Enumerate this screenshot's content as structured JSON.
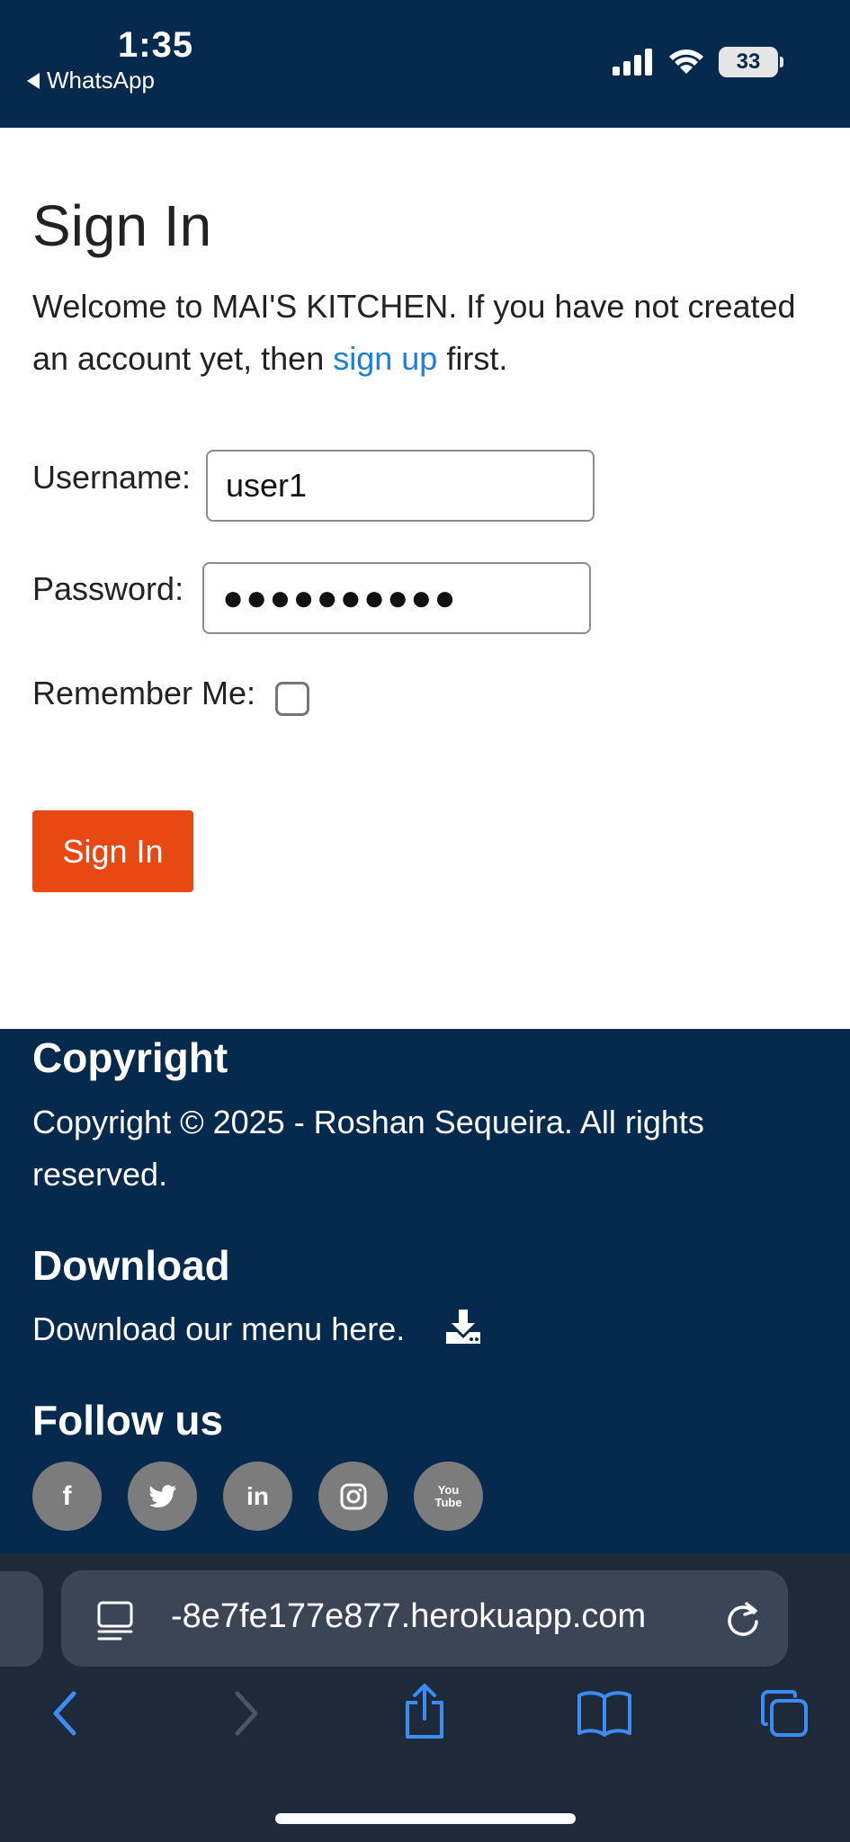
{
  "status_bar": {
    "time": "1:35",
    "back_label": "WhatsApp",
    "battery": "33"
  },
  "main": {
    "title": "Sign In",
    "welcome_text_1": "Welcome to MAI'S KITCHEN. If you have not created an account yet, then ",
    "signup_link": "sign up",
    "welcome_text_2": " first.",
    "username_label": "Username:",
    "username_value": "user1",
    "password_label": "Password:",
    "password_value": "●●●●●●●●●●",
    "remember_label": "Remember Me:",
    "signin_button": "Sign In"
  },
  "footer": {
    "copyright_heading": "Copyright",
    "copyright_text": "Copyright © 2025 - Roshan Sequeira. All rights reserved.",
    "download_heading": "Download",
    "download_text": "Download our menu here.",
    "follow_heading": "Follow us",
    "socials": [
      {
        "name": "facebook",
        "glyph": "f"
      },
      {
        "name": "twitter",
        "glyph": "t"
      },
      {
        "name": "linkedin",
        "glyph": "in"
      },
      {
        "name": "instagram",
        "glyph": ""
      },
      {
        "name": "youtube",
        "glyph": "You Tube"
      }
    ]
  },
  "browser": {
    "url": "-8e7fe177e877.herokuapp.com"
  },
  "colors": {
    "navy": "#052a4d",
    "accent_orange": "#e84912",
    "link_blue": "#1a7fe0",
    "browser_blue": "#3b8df5"
  }
}
